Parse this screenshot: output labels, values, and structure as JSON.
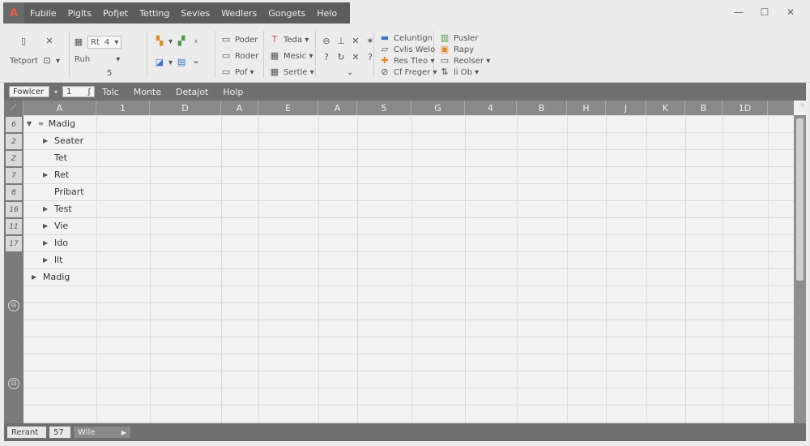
{
  "app": {
    "icon_letter": "A"
  },
  "menu": [
    "Fubile",
    "Piglts",
    "Pofjet",
    "Tetting",
    "Sevies",
    "Wedlers",
    "Gongets",
    "Helo"
  ],
  "window_controls": [
    "—",
    "☐",
    "✕"
  ],
  "ribbon": {
    "clipboard": {
      "label1": "Tetport",
      "label2": "Ruh",
      "combo_value": "Rt",
      "combo_num": "4",
      "num": "5"
    },
    "font": {
      "b1": "Poder",
      "b2": "Roder",
      "b3": "Pof ▾"
    },
    "styles": {
      "b1": "Teda ▾",
      "b2": "Mesic ▾",
      "b3": "Sertle ▾"
    },
    "arrange": {
      "b1": "Celuntign",
      "b2": "Cvlis Welo",
      "b3": "Res Tleo ▾",
      "b4": "Cf Freger ▾"
    },
    "editing": {
      "b1": "Pusler",
      "b2": "Rapy",
      "b3": "Reolser ▾",
      "b4": "li Ob ▾"
    }
  },
  "toolstrip": {
    "name_box": "Fowlcer",
    "cell_ref": "1",
    "menu": [
      "Tolc",
      "Monte",
      "Detajot",
      "Holp"
    ]
  },
  "columns": [
    "A",
    "1",
    "D",
    "A",
    "E",
    "A",
    "5",
    "G",
    "4",
    "B",
    "H",
    "J",
    "K",
    "B",
    "1D"
  ],
  "rows": [
    "6",
    "2",
    "Z",
    "7",
    "8",
    "16",
    "11",
    "17"
  ],
  "tree": [
    {
      "label": "Madig",
      "level": 0,
      "arrow": "▼"
    },
    {
      "label": "Seater",
      "level": 1,
      "arrow": "▶"
    },
    {
      "label": "Tet",
      "level": 1,
      "arrow": ""
    },
    {
      "label": "Ret",
      "level": 1,
      "arrow": "▶"
    },
    {
      "label": "Pribart",
      "level": 1,
      "arrow": ""
    },
    {
      "label": "Test",
      "level": 1,
      "arrow": "▶"
    },
    {
      "label": "Vie",
      "level": 1,
      "arrow": "▶"
    },
    {
      "label": "Ido",
      "level": 1,
      "arrow": "▶"
    },
    {
      "label": "llt",
      "level": 1,
      "arrow": "▶"
    },
    {
      "label": "Madig",
      "level": 0,
      "arrow": "▶"
    }
  ],
  "statusbar": {
    "mode": "Rerant",
    "count": "57",
    "sheet": "Wile"
  }
}
